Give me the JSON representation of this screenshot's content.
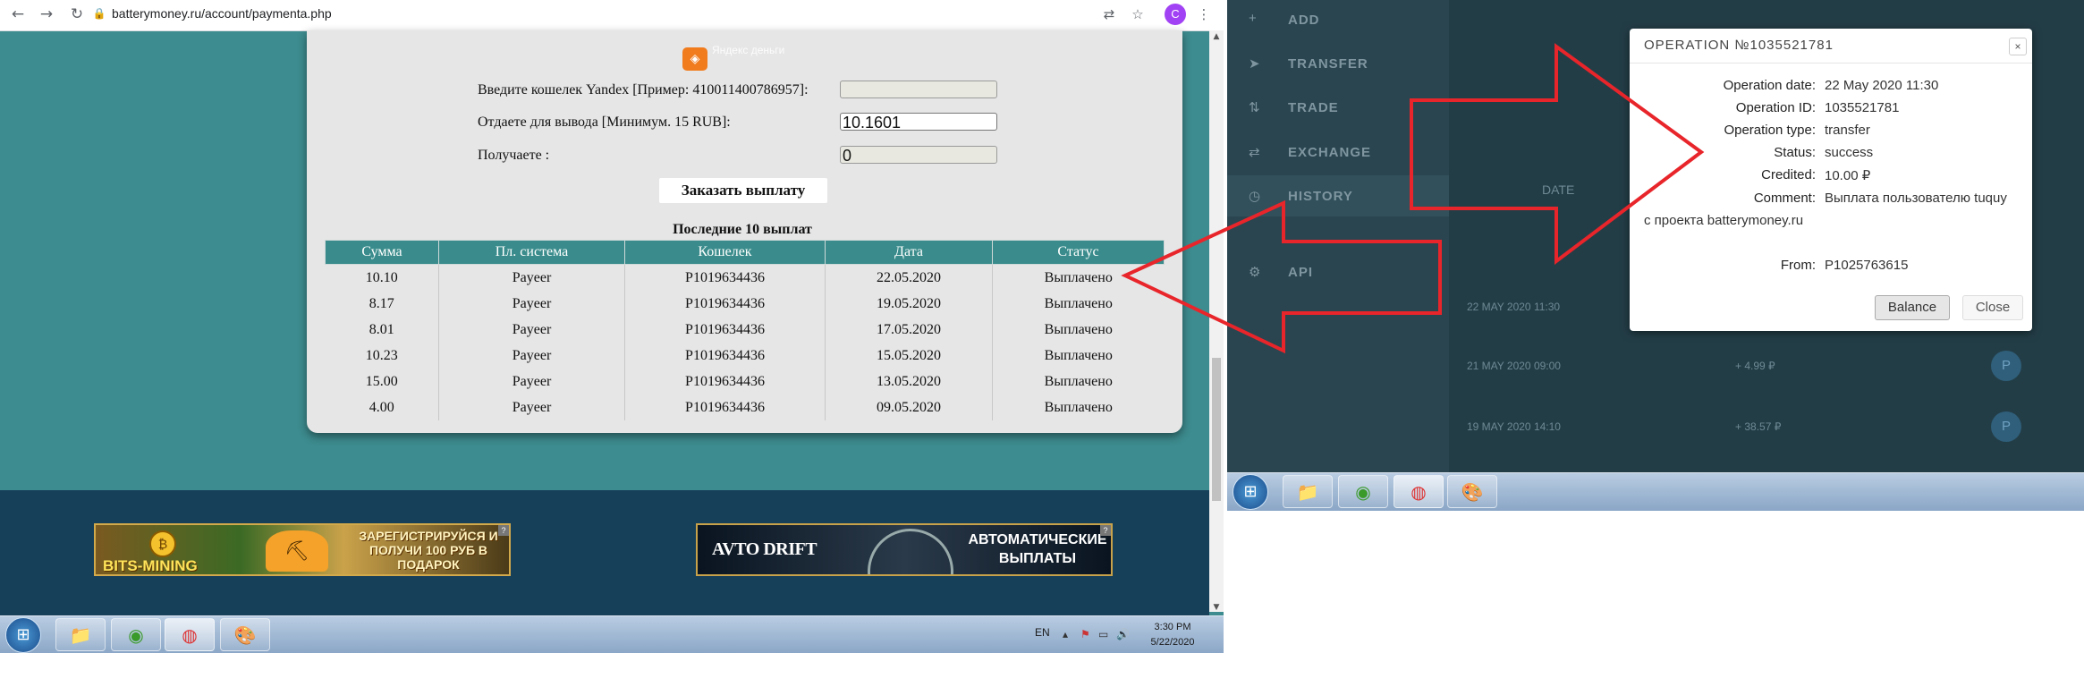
{
  "browser": {
    "url": "batterymoney.ru/account/paymenta.php",
    "nav_back": "←",
    "nav_forward": "→",
    "nav_reload": "↻",
    "lock_glyph": "🔒",
    "translate_glyph": "⇄",
    "star_glyph": "☆",
    "menu_glyph": "⋮",
    "avatar_letter": "C"
  },
  "yandex_logo_text": "Яндекс деньги",
  "form": {
    "wallet_label": "Введите кошелек Yandex [Пример: 410011400786957]:",
    "wallet_value": "",
    "withdraw_label": "Отдаете для вывода [Минимум. 15 RUB]:",
    "withdraw_value": "10.1601",
    "receive_label": "Получаете :",
    "receive_value": "0",
    "order_button": "Заказать выплату"
  },
  "payouts": {
    "caption": "Последние 10 выплат",
    "columns": [
      "Сумма",
      "Пл. система",
      "Кошелек",
      "Дата",
      "Статус"
    ],
    "rows": [
      [
        "10.10",
        "Payeer",
        "P1019634436",
        "22.05.2020",
        "Выплачено"
      ],
      [
        "8.17",
        "Payeer",
        "P1019634436",
        "19.05.2020",
        "Выплачено"
      ],
      [
        "8.01",
        "Payeer",
        "P1019634436",
        "17.05.2020",
        "Выплачено"
      ],
      [
        "10.23",
        "Payeer",
        "P1019634436",
        "15.05.2020",
        "Выплачено"
      ],
      [
        "15.00",
        "Payeer",
        "P1019634436",
        "13.05.2020",
        "Выплачено"
      ],
      [
        "4.00",
        "Payeer",
        "P1019634436",
        "09.05.2020",
        "Выплачено"
      ]
    ]
  },
  "banners": {
    "bits_mining_title": "BITS-MINING",
    "bits_mining_text": "ЗАРЕГИСТРИРУЙСЯ И ПОЛУЧИ 100 РУБ В ПОДАРОК",
    "avto_drift_title": "AVTO DRIFT",
    "avto_drift_text": "АВТОМАТИЧЕСКИЕ ВЫПЛАТЫ",
    "close_glyph": "?"
  },
  "taskbar": {
    "lang": "EN",
    "time": "3:30 PM",
    "date": "5/22/2020",
    "tray_glyphs": [
      "▴",
      "⚑",
      "▭",
      "🔊"
    ]
  },
  "right_site": {
    "menu": [
      "ADD",
      "TRANSFER",
      "TRADE",
      "EXCHANGE",
      "HISTORY",
      "API"
    ],
    "menu_icons": [
      "+",
      "➤",
      "⇅",
      "⇄",
      "◷",
      "⚙"
    ],
    "ghost_date_header": "DATE",
    "ghost_row_dates": [
      "22 MAY 2020 11:30",
      "21 MAY 2020 09:00",
      "19 MAY 2020 14:10"
    ],
    "ghost_amounts": [
      "+ 4.99 ₽",
      "+ 38.57 ₽"
    ],
    "ghost_p": "P"
  },
  "modal": {
    "title": "OPERATION №1035521781",
    "close_x": "×",
    "fields": [
      {
        "label": "Operation date:",
        "value": "22 May 2020 11:30"
      },
      {
        "label": "Operation ID:",
        "value": "1035521781"
      },
      {
        "label": "Operation type:",
        "value": "transfer"
      },
      {
        "label": "Status:",
        "value": "success"
      },
      {
        "label": "Credited:",
        "value": "10.00 ₽"
      },
      {
        "label": "Comment:",
        "value": "Выплата пользователю tuquy"
      }
    ],
    "comment_cont": "с проекта batterymoney.ru",
    "from_label": "From:",
    "from_value": "P1025763615",
    "balance_button": "Balance",
    "close_button": "Close"
  },
  "colors": {
    "arrow": "#e8252a",
    "table_header": "#3a8c8c",
    "page_teal": "#3d8c8f",
    "footer_navy": "#163f5a"
  }
}
